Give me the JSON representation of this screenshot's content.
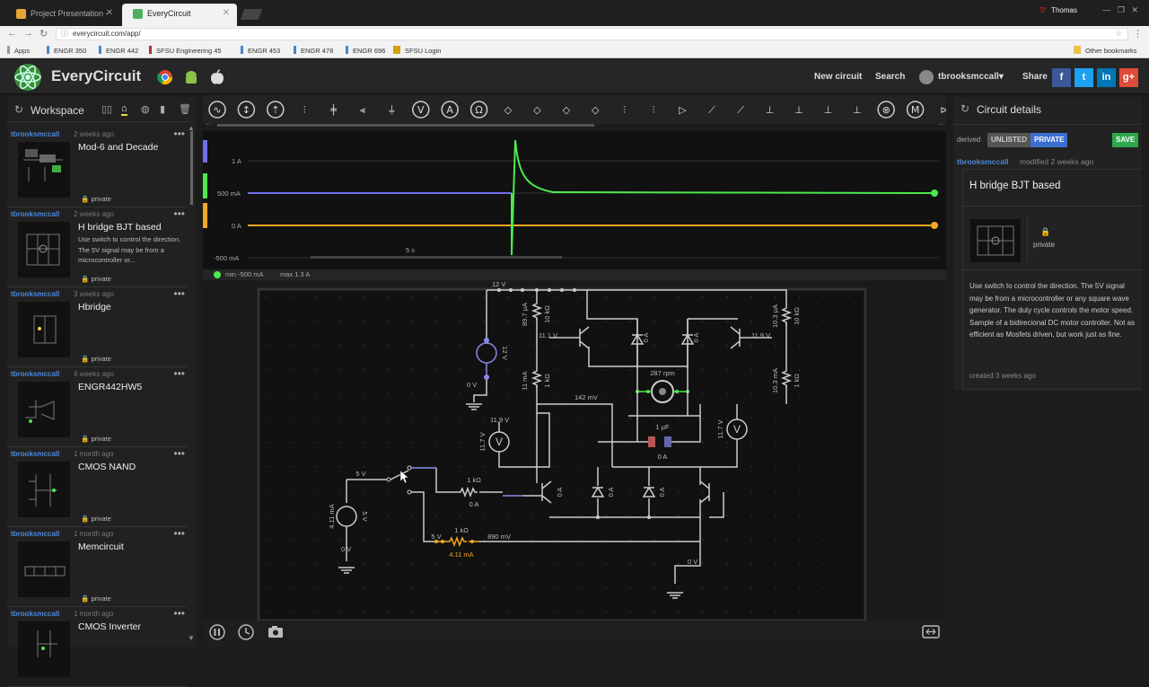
{
  "browser": {
    "tabs": [
      {
        "label": "Project Presentation - G",
        "active": false,
        "color": "#e5a634"
      },
      {
        "label": "EveryCircuit",
        "active": true,
        "color": "#4cb15f"
      }
    ],
    "user": "Thomas",
    "url": "everycircuit.com/app/",
    "bookmarks": [
      "Apps",
      "ENGR 350",
      "ENGR 442",
      "SFSU Engineering 45",
      "ENGR 453",
      "ENGR 478",
      "ENGR 696",
      "SFSU Login"
    ],
    "other_bookmarks": "Other bookmarks"
  },
  "header": {
    "brand": "EveryCircuit",
    "new_circuit": "New circuit",
    "search": "Search",
    "username": "tbrooksmccall",
    "share": "Share",
    "social": [
      "f",
      "t",
      "in",
      "g+"
    ]
  },
  "workspace": {
    "title": "Workspace",
    "circuits": [
      {
        "owner": "tbrooksmccall",
        "ago": "2 weeks ago",
        "title": "Mod-6 and Decade",
        "desc": "",
        "priv": "private"
      },
      {
        "owner": "tbrooksmccall",
        "ago": "2 weeks ago",
        "title": "H bridge BJT based",
        "desc": "Use switch to control the direction. The 5V signal may be from a microcontroller or...",
        "priv": "private"
      },
      {
        "owner": "tbrooksmccall",
        "ago": "3 weeks ago",
        "title": "Hbridge",
        "desc": "",
        "priv": "private"
      },
      {
        "owner": "tbrooksmccall",
        "ago": "4 weeks ago",
        "title": "ENGR442HW5",
        "desc": "",
        "priv": "private"
      },
      {
        "owner": "tbrooksmccall",
        "ago": "1 month ago",
        "title": "CMOS NAND",
        "desc": "",
        "priv": "private"
      },
      {
        "owner": "tbrooksmccall",
        "ago": "1 month ago",
        "title": "Memcircuit",
        "desc": "",
        "priv": "private"
      },
      {
        "owner": "tbrooksmccall",
        "ago": "1 month ago",
        "title": "CMOS Inverter",
        "desc": "",
        "priv": ""
      }
    ]
  },
  "scope": {
    "y_labels": [
      "1 A",
      "500 mA",
      "0 A",
      "-500 mA"
    ],
    "time_label": "5 s",
    "min_label": "min  -500 mA",
    "max_label": "max  1.3 A",
    "colors": {
      "blue": "#6f6fe8",
      "green": "#4de84d",
      "orange": "#f5a623"
    }
  },
  "circuit_labels": {
    "v12": "12 V",
    "r_top_left": "89.7 μA",
    "r_top_left_val": "10 kΩ",
    "v11_1": "11.1 V",
    "v11_9_r": "11.9 V",
    "r_top_right": "10.3 μA",
    "r_top_right_val": "10 kΩ",
    "src_val": "12 V",
    "src_zero": "0 V",
    "r_mid_left": "11 mA",
    "r_mid_left_val": "1 kΩ",
    "mid_v": "142 mV",
    "rpm": "287 rpm",
    "r_mid_right": "10.3 mA",
    "r_mid_right_val": "1 kΩ",
    "v11_9_l": "11.9 V",
    "vm_l": "11.7 V",
    "vm_r": "11.7 V",
    "cap": "1 μF",
    "cap_i": "0 A",
    "d1": "0 A",
    "d2": "0 A",
    "d3": "0 A",
    "d4": "0 A",
    "d5": "0 A",
    "d6": "0 A",
    "v5_top": "5 V",
    "r1k_1": "1 kΩ",
    "r1k_1_i": "0 A",
    "src5": "5 V",
    "src5_i": "4.11 mA",
    "src5_zero": "0 V",
    "r1k_2_v": "5 V",
    "r1k_2": "1 kΩ",
    "r1k_2_i": "4.11 mA",
    "mv890": "890 mV",
    "gnd_r": "0 V"
  },
  "details": {
    "title": "Circuit details",
    "derived": "derived",
    "unlisted": "UNLISTED",
    "private": "PRIVATE",
    "save": "SAVE",
    "owner": "tbrooksmccall",
    "modified": "modified 2 weeks ago",
    "name": "H bridge BJT based",
    "priv": "private",
    "description": "Use switch to control the direction. The 5V signal may be from a microcontroller or any square wave generator. The duty cycle controls the motor speed.",
    "description2": "Sample of a bidirecional DC motor controller. Not as efficient as Mosfets driven, but work just as fine.",
    "created": "created 3 weeks ago"
  }
}
